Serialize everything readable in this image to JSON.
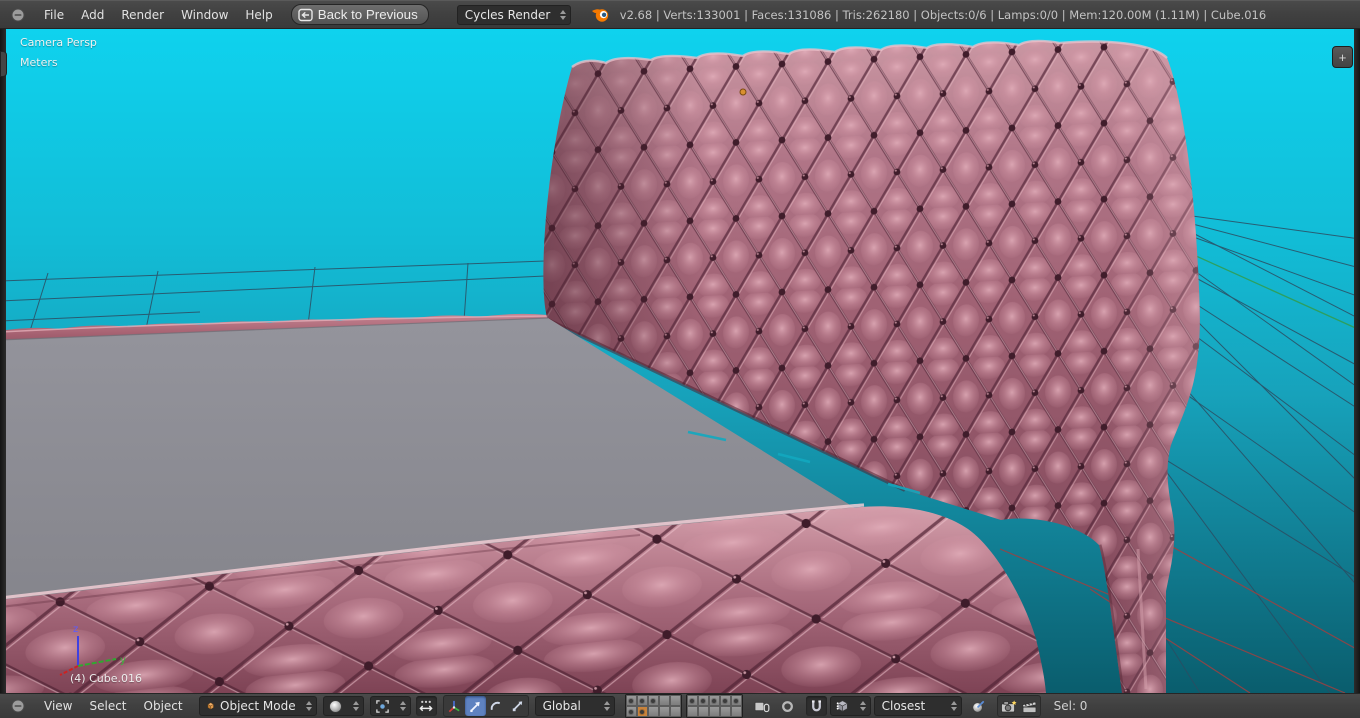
{
  "topbar": {
    "menus": [
      "File",
      "Add",
      "Render",
      "Window",
      "Help"
    ],
    "back_button": "Back to Previous",
    "engine": "Cycles Render",
    "stats": "v2.68 | Verts:133001 | Faces:131086 | Tris:262180 | Objects:0/6 | Lamps:0/0 | Mem:120.00M (1.11M) | Cube.016"
  },
  "viewport": {
    "view_label": "Camera Persp",
    "units_label": "Meters",
    "active_object_label": "(4) Cube.016",
    "add_panel_button": "+",
    "axis_labels": {
      "z": "z",
      "y": "y"
    }
  },
  "bottombar": {
    "menus": [
      "View",
      "Select",
      "Object"
    ],
    "mode_select": "Object Mode",
    "orientation_select": "Global",
    "snap_target_select": "Closest",
    "selection_count": "Sel: 0",
    "layers": {
      "group1": [
        1,
        1,
        1,
        0,
        0,
        1,
        2,
        0,
        0,
        0
      ],
      "group2": [
        1,
        1,
        1,
        1,
        1,
        0,
        0,
        0,
        0,
        0
      ]
    }
  },
  "colors": {
    "header_bg": "#414141",
    "header_text": "#d8d8d8",
    "select_bg": "#2e2e2e",
    "sky_top": "#0fd2ee",
    "sky_bottom": "#0a5d6d",
    "fabric_light": "#cb97a3",
    "fabric_mid": "#9c6070",
    "fabric_dark": "#6e3a49",
    "mattress_gray": "#8b8b93",
    "grid_line": "#2c4d62",
    "grid_green": "#2f9e54",
    "grid_red": "#9f4040",
    "active_layer": "#c8833c",
    "active_button": "#5f82c0",
    "origin_dot": "#d9902f"
  }
}
